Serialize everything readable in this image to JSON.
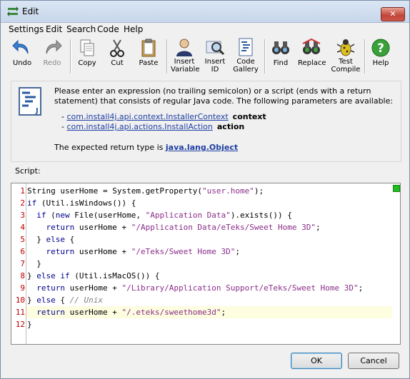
{
  "window": {
    "title": "Edit",
    "close_label": "✕"
  },
  "menu": [
    "Settings",
    "Edit",
    "Search",
    "Code",
    "Help"
  ],
  "toolbar": {
    "undo": "Undo",
    "redo": "Redo",
    "copy": "Copy",
    "cut": "Cut",
    "paste": "Paste",
    "insert_variable_1": "Insert",
    "insert_variable_2": "Variable",
    "insert_id_1": "Insert",
    "insert_id_2": "ID",
    "code_gallery_1": "Code",
    "code_gallery_2": "Gallery",
    "find": "Find",
    "replace": "Replace",
    "test_compile_1": "Test",
    "test_compile_2": "Compile",
    "help": "Help"
  },
  "info": {
    "description": "Please enter an expression (no trailing semicolon) or a script (ends with a return statement) that consists of regular Java code. The following parameters are available:",
    "params": [
      {
        "prefix": "- ",
        "type": "com.install4j.api.context.InstallerContext",
        "name": "context"
      },
      {
        "prefix": "- ",
        "type": "com.install4j.api.actions.InstallAction",
        "name": "action"
      }
    ],
    "return_prefix": "The expected return type is ",
    "return_type": "java.lang.Object"
  },
  "script_label": "Script:",
  "code_lines": [
    "1",
    "2",
    "3",
    "4",
    "5",
    "6",
    "7",
    "8",
    "9",
    "10",
    "11",
    "12"
  ],
  "code": {
    "l1a": "String userHome = System.getProperty(",
    "l1s": "\"user.home\"",
    "l1b": ");",
    "l2k": "if",
    "l2b": " (Util.isWindows()) {",
    "l3k1": "  if",
    "l3b1": " (",
    "l3k2": "new",
    "l3b2": " File(userHome, ",
    "l3s": "\"Application Data\"",
    "l3b3": ").exists()) {",
    "l4k": "    return",
    "l4b": " userHome + ",
    "l4s": "\"/Application Data/eTeks/Sweet Home 3D\"",
    "l4c": ";",
    "l5a": "  } ",
    "l5k": "else",
    "l5b": " {",
    "l6k": "    return",
    "l6b": " userHome + ",
    "l6s": "\"/eTeks/Sweet Home 3D\"",
    "l6c": ";",
    "l7": "  }",
    "l8a": "} ",
    "l8k1": "else if",
    "l8b": " (Util.isMacOS()) {",
    "l9k": "  return",
    "l9b": " userHome + ",
    "l9s": "\"/Library/Application Support/eTeks/Sweet Home 3D\"",
    "l9c": ";",
    "l10a": "} ",
    "l10k": "else",
    "l10b": " { ",
    "l10cm": "// Unix",
    "l11k": "  return",
    "l11b": " userHome + ",
    "l11s": "\"/.eteks/sweethome3d\"",
    "l11c": ";",
    "l12": "}"
  },
  "buttons": {
    "ok": "OK",
    "cancel": "Cancel"
  },
  "colors": {
    "keyword": "#00008b",
    "string": "#8a2e8a",
    "comment": "#808080",
    "line_number": "#c00000",
    "link": "#1f3fa3"
  }
}
